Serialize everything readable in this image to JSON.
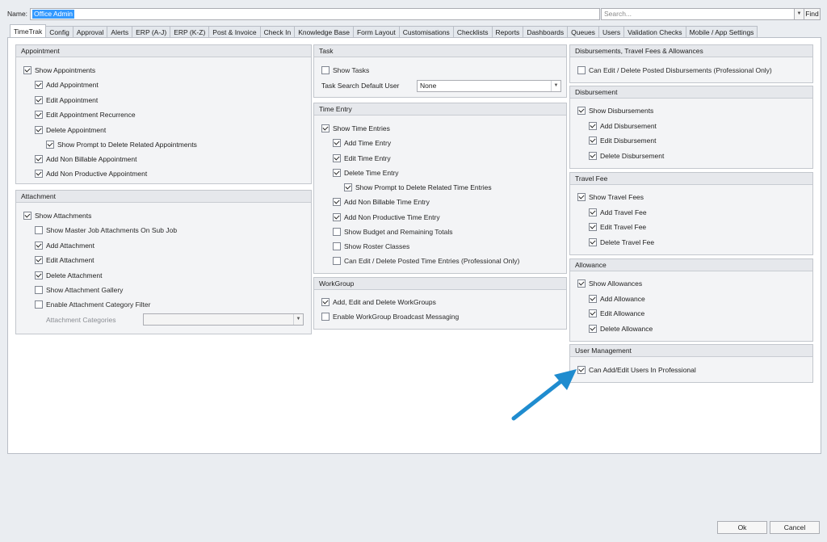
{
  "header": {
    "name_label": "Name:",
    "name_value": "Office Admin",
    "search_placeholder": "Search...",
    "find_label": "Find"
  },
  "tabs": [
    "TimeTrak",
    "Config",
    "Approval",
    "Alerts",
    "ERP (A-J)",
    "ERP (K-Z)",
    "Post & Invoice",
    "Check In",
    "Knowledge Base",
    "Form Layout",
    "Customisations",
    "Checklists",
    "Reports",
    "Dashboards",
    "Queues",
    "Users",
    "Validation Checks",
    "Mobile / App Settings"
  ],
  "appointment": {
    "title": "Appointment",
    "items": [
      "Show Appointments",
      "Add Appointment",
      "Edit Appointment",
      "Edit Appointment Recurrence",
      "Delete Appointment",
      "Show Prompt to Delete Related Appointments",
      "Add Non Billable Appointment",
      "Add Non Productive Appointment"
    ]
  },
  "attachment": {
    "title": "Attachment",
    "items": [
      "Show Attachments",
      "Show Master Job Attachments On Sub Job",
      "Add Attachment",
      "Edit Attachment",
      "Delete Attachment",
      "Show Attachment Gallery",
      "Enable Attachment Category Filter"
    ],
    "categories_label": "Attachment Categories"
  },
  "task": {
    "title": "Task",
    "show_tasks": "Show Tasks",
    "default_user_label": "Task Search Default User",
    "default_user_value": "None"
  },
  "time_entry": {
    "title": "Time Entry",
    "items": [
      "Show Time Entries",
      "Add Time Entry",
      "Edit Time Entry",
      "Delete Time Entry",
      "Show Prompt to Delete Related Time Entries",
      "Add Non Billable Time Entry",
      "Add Non Productive Time Entry",
      "Show Budget and Remaining Totals",
      "Show Roster Classes",
      "Can Edit / Delete Posted Time Entries (Professional Only)"
    ]
  },
  "workgroup": {
    "title": "WorkGroup",
    "items": [
      "Add, Edit and Delete WorkGroups",
      "Enable WorkGroup Broadcast Messaging"
    ]
  },
  "dtfa": {
    "title": "Disbursements, Travel Fees & Allowances",
    "items": [
      "Can Edit / Delete Posted Disbursements (Professional Only)"
    ]
  },
  "disbursement": {
    "title": "Disbursement",
    "items": [
      "Show Disbursements",
      "Add Disbursement",
      "Edit Disbursement",
      "Delete Disbursement"
    ]
  },
  "travel_fee": {
    "title": "Travel Fee",
    "items": [
      "Show Travel Fees",
      "Add Travel Fee",
      "Edit Travel Fee",
      "Delete Travel Fee"
    ]
  },
  "allowance": {
    "title": "Allowance",
    "items": [
      "Show Allowances",
      "Add Allowance",
      "Edit Allowance",
      "Delete Allowance"
    ]
  },
  "user_management": {
    "title": "User Management",
    "items": [
      "Can Add/Edit Users In Professional"
    ]
  },
  "footer": {
    "ok_label": "Ok",
    "cancel_label": "Cancel"
  },
  "colors": {
    "arrow": "#1f8ccf",
    "selection": "#3399ff"
  }
}
